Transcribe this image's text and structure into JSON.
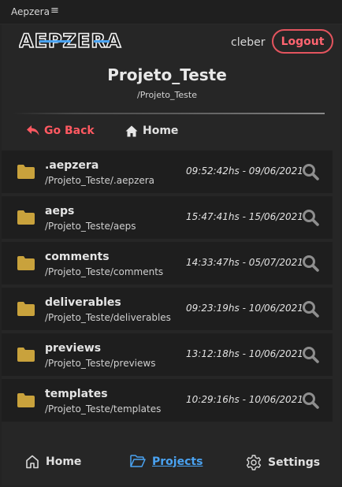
{
  "window": {
    "title": "Aepzera",
    "menu_glyph": "≡"
  },
  "header": {
    "logo_text": "AEPZERA",
    "username": "cleber",
    "logout_label": "Logout"
  },
  "project": {
    "title": "Projeto_Teste",
    "path": "/Projeto_Teste"
  },
  "nav": {
    "go_back_label": "Go Back",
    "home_label": "Home"
  },
  "folders": [
    {
      "name": ".aepzera",
      "path": "/Projeto_Teste/.aepzera",
      "modified": "09:52:42hs - 09/06/2021"
    },
    {
      "name": "aeps",
      "path": "/Projeto_Teste/aeps",
      "modified": "15:47:41hs - 15/06/2021"
    },
    {
      "name": "comments",
      "path": "/Projeto_Teste/comments",
      "modified": "14:33:47hs - 05/07/2021"
    },
    {
      "name": "deliverables",
      "path": "/Projeto_Teste/deliverables",
      "modified": "09:23:19hs - 10/06/2021"
    },
    {
      "name": "previews",
      "path": "/Projeto_Teste/previews",
      "modified": "13:12:18hs - 10/06/2021"
    },
    {
      "name": "templates",
      "path": "/Projeto_Teste/templates",
      "modified": "10:29:16hs - 10/06/2021"
    }
  ],
  "bottom_nav": {
    "home_label": "Home",
    "projects_label": "Projects",
    "settings_label": "Settings",
    "active": "Projects"
  },
  "colors": {
    "accent_blue": "#4aa3f2",
    "danger_red": "#ff5961",
    "folder_gold": "#c9a23c"
  }
}
